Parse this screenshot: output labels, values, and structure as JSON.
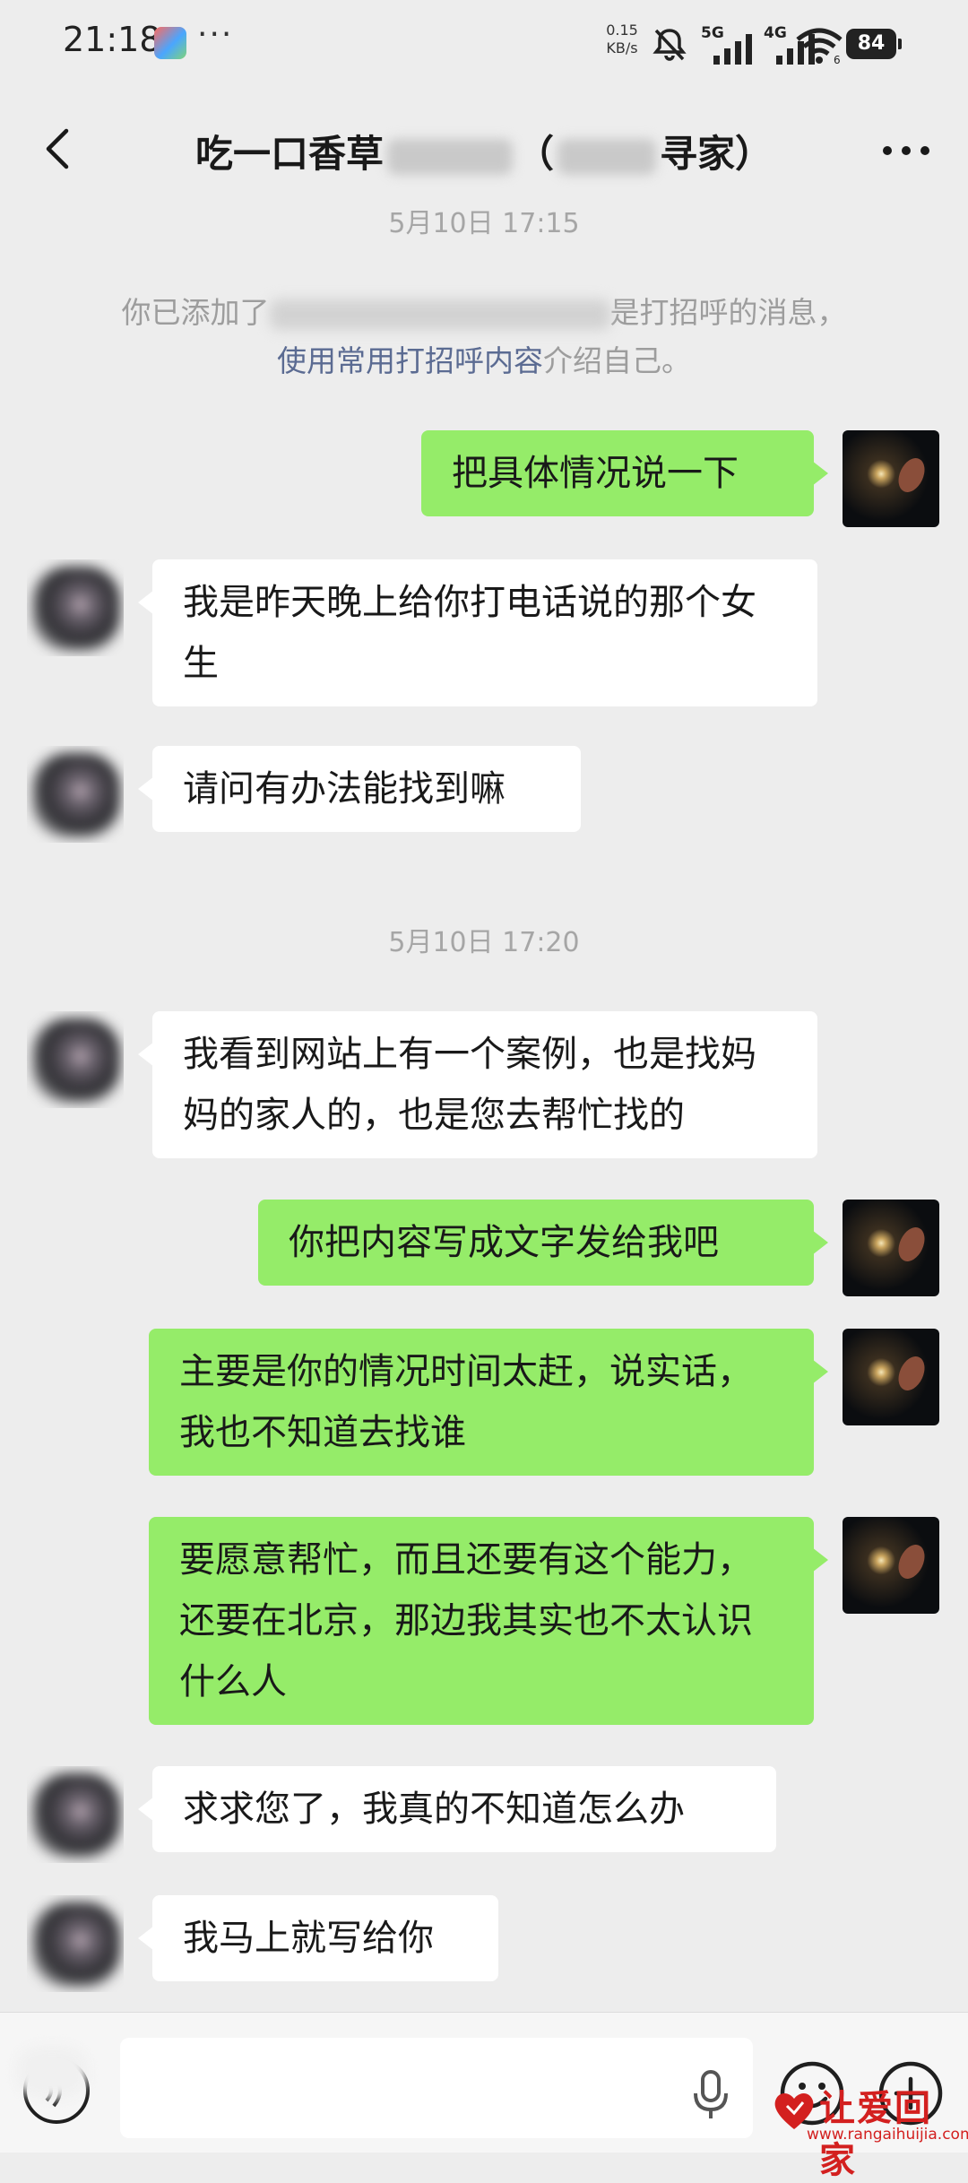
{
  "status_bar": {
    "time": "21:18",
    "more": "···",
    "net_speed_value": "0.15",
    "net_speed_unit": "KB/s",
    "signal_1": "5G",
    "signal_2": "4G",
    "wifi_sub": "6",
    "battery": "84"
  },
  "header": {
    "title_left": "吃一口香草",
    "title_right": "寻家）",
    "title_hidden_part": "(partially blurred)",
    "back_icon": "chevron-left-icon",
    "more_icon": "more-dots-icon"
  },
  "chat": {
    "timestamp_top": "5月10日 17:15",
    "system_line1_a": "你已添加了",
    "system_line1_b": "是打招呼的消息，",
    "system_line2_link": "使用常用打招呼内容",
    "system_line2_rest": "介绍自己。",
    "timestamp_mid": "5月10日 17:20",
    "messages": [
      {
        "sender": "me",
        "text": "把具体情况说一下"
      },
      {
        "sender": "other",
        "text": "我是昨天晚上给你打电话说的那个女生"
      },
      {
        "sender": "other",
        "text": "请问有办法能找到嘛"
      },
      {
        "sender": "other",
        "text": "我看到网站上有一个案例，也是找妈妈的家人的，也是您去帮忙找的"
      },
      {
        "sender": "me",
        "text": "你把内容写成文字发给我吧"
      },
      {
        "sender": "me",
        "text": "主要是你的情况时间太赶，说实话，我也不知道去找谁"
      },
      {
        "sender": "me",
        "text": "要愿意帮忙，而且还要有这个能力，还要在北京，那边我其实也不太认识什么人"
      },
      {
        "sender": "other",
        "text": "求求您了，我真的不知道怎么办"
      },
      {
        "sender": "other",
        "text": "我马上就写给你"
      }
    ]
  },
  "input_bar": {
    "placeholder": "",
    "icons": [
      "voice-icon",
      "mic-icon",
      "emoji-icon",
      "plus-icon"
    ]
  },
  "watermark": {
    "title": "让爱回家",
    "url": "www.rangaihuijia.com"
  },
  "colors": {
    "bubble_me": "#95ec69",
    "bubble_other": "#ffffff",
    "background": "#ededed",
    "link": "#5b6b92"
  }
}
